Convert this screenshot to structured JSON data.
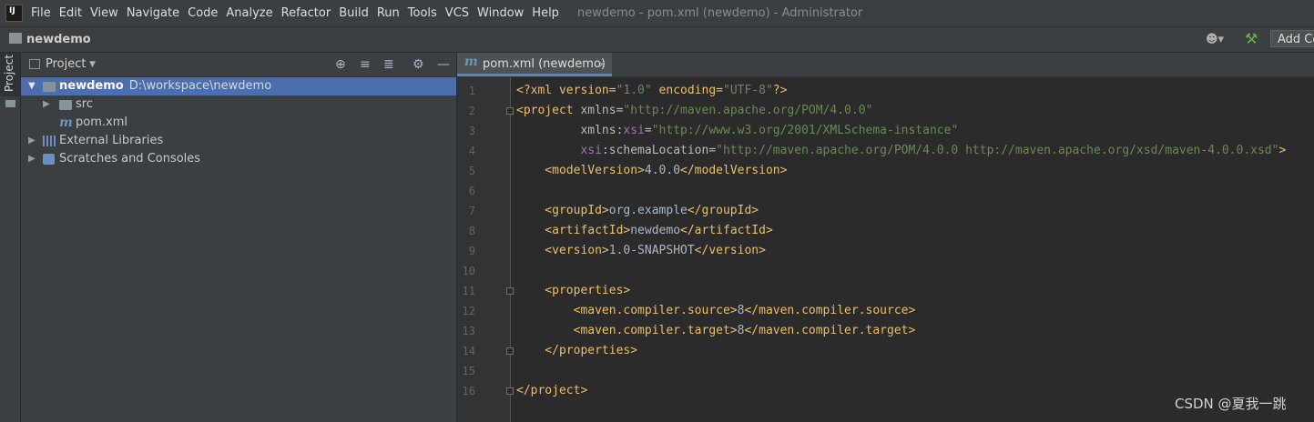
{
  "app": {
    "logo_text": "IJ",
    "menu": [
      "File",
      "Edit",
      "View",
      "Navigate",
      "Code",
      "Analyze",
      "Refactor",
      "Build",
      "Run",
      "Tools",
      "VCS",
      "Window",
      "Help"
    ],
    "window_title": "newdemo - pom.xml (newdemo) - Administrator"
  },
  "navbar": {
    "project_name": "newdemo",
    "add_config_label": "Add Co"
  },
  "tool_stripe": {
    "project_tab_label": "Project"
  },
  "project_panel": {
    "title": "Project",
    "tree": [
      {
        "label": "newdemo",
        "detail": "D:\\workspace\\newdemo",
        "icon": "project-folder-icon",
        "selected": true
      },
      {
        "label": "src",
        "icon": "folder-icon"
      },
      {
        "label": "pom.xml",
        "icon": "maven-file-icon"
      },
      {
        "label": "External Libraries",
        "icon": "library-icon"
      },
      {
        "label": "Scratches and Consoles",
        "icon": "scratches-icon"
      }
    ]
  },
  "editor": {
    "tab_label": "pom.xml (newdemo)",
    "line_numbers": [
      "1",
      "2",
      "3",
      "4",
      "5",
      "6",
      "7",
      "8",
      "9",
      "10",
      "11",
      "12",
      "13",
      "14",
      "15",
      "16"
    ],
    "lines": [
      [
        [
          "pi",
          "<?xml version="
        ],
        [
          "val",
          "\"1.0\""
        ],
        [
          "pi",
          " encoding="
        ],
        [
          "val",
          "\"UTF-8\""
        ],
        [
          "pi",
          "?>"
        ]
      ],
      [
        [
          "tag",
          "<project "
        ],
        [
          "attr",
          "xmlns="
        ],
        [
          "val",
          "\"http://maven.apache.org/POM/4.0.0\""
        ]
      ],
      [
        [
          "attr",
          "         xmlns:"
        ],
        [
          "ns",
          "xsi"
        ],
        [
          "attr",
          "="
        ],
        [
          "val",
          "\"http://www.w3.org/2001/XMLSchema-instance\""
        ]
      ],
      [
        [
          "ns",
          "         xsi"
        ],
        [
          "attr",
          ":schemaLocation="
        ],
        [
          "val",
          "\"http://maven.apache.org/POM/4.0.0 http://maven.apache.org/xsd/maven-4.0.0.xsd\""
        ],
        [
          "tag",
          ">"
        ]
      ],
      [
        [
          "tag",
          "    <modelVersion>"
        ],
        [
          "text",
          "4.0.0"
        ],
        [
          "tag",
          "</modelVersion>"
        ]
      ],
      [],
      [
        [
          "tag",
          "    <groupId>"
        ],
        [
          "text",
          "org.example"
        ],
        [
          "tag",
          "</groupId>"
        ]
      ],
      [
        [
          "tag",
          "    <artifactId>"
        ],
        [
          "text",
          "newdemo"
        ],
        [
          "tag",
          "</artifactId>"
        ]
      ],
      [
        [
          "tag",
          "    <version>"
        ],
        [
          "text",
          "1.0-SNAPSHOT"
        ],
        [
          "tag",
          "</version>"
        ]
      ],
      [],
      [
        [
          "tag",
          "    <properties>"
        ]
      ],
      [
        [
          "tag",
          "        <maven.compiler.source>"
        ],
        [
          "text",
          "8"
        ],
        [
          "tag",
          "</maven.compiler.source>"
        ]
      ],
      [
        [
          "tag",
          "        <maven.compiler.target>"
        ],
        [
          "text",
          "8"
        ],
        [
          "tag",
          "</maven.compiler.target>"
        ]
      ],
      [
        [
          "tag",
          "    </properties>"
        ]
      ],
      [],
      [
        [
          "tag",
          "</project>"
        ]
      ]
    ],
    "fold_lines": [
      2,
      11,
      14,
      16
    ]
  },
  "watermark": "CSDN @夏我一跳",
  "colors": {
    "tag": "#e8bf6a",
    "attribute": "#bababa",
    "value": "#6a8759",
    "namespace": "#9876aa",
    "text": "#a9b7c6",
    "selection": "#4b6eaf"
  }
}
